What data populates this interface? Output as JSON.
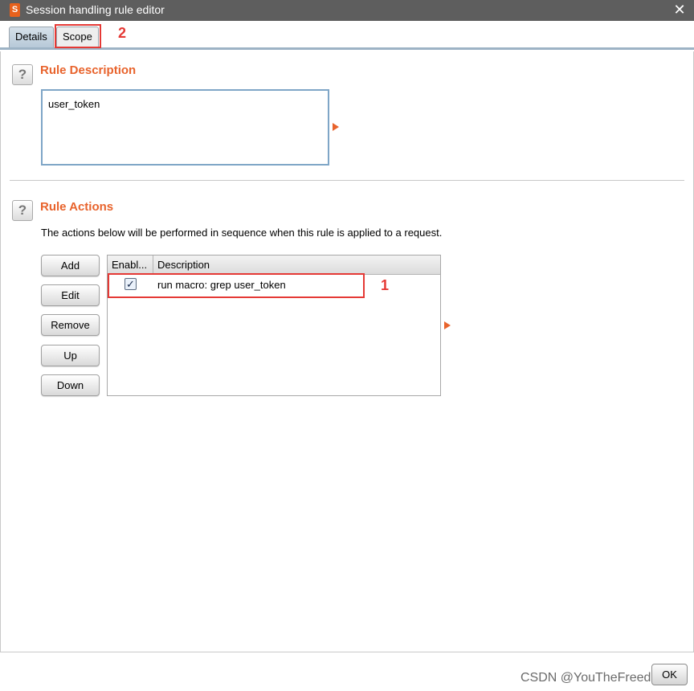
{
  "window": {
    "title": "Session handling rule editor",
    "app_icon_glyph": "S",
    "close_glyph": "✕"
  },
  "tabs": [
    {
      "label": "Details",
      "active": true
    },
    {
      "label": "Scope",
      "active": false
    }
  ],
  "annotations": {
    "scope_marker": "2",
    "row_marker": "1",
    "color": "#e53935"
  },
  "rule_description": {
    "help_glyph": "?",
    "title": "Rule Description",
    "value": "user_token"
  },
  "rule_actions": {
    "help_glyph": "?",
    "title": "Rule Actions",
    "note": "The actions below will be performed in sequence when this rule is applied to a request.",
    "buttons": {
      "add": "Add",
      "edit": "Edit",
      "remove": "Remove",
      "up": "Up",
      "down": "Down"
    },
    "columns": [
      "Enabl...",
      "Description"
    ],
    "rows": [
      {
        "enabled": true,
        "check_glyph": "✓",
        "description": "run macro: grep user_token"
      }
    ]
  },
  "footer": {
    "watermark": "CSDN @YouTheFreedom",
    "ok_label": "OK"
  },
  "colors": {
    "section_title": "#e8632c",
    "titlebar": "#5e5e5e",
    "tab_active": "#b7c9d8"
  }
}
